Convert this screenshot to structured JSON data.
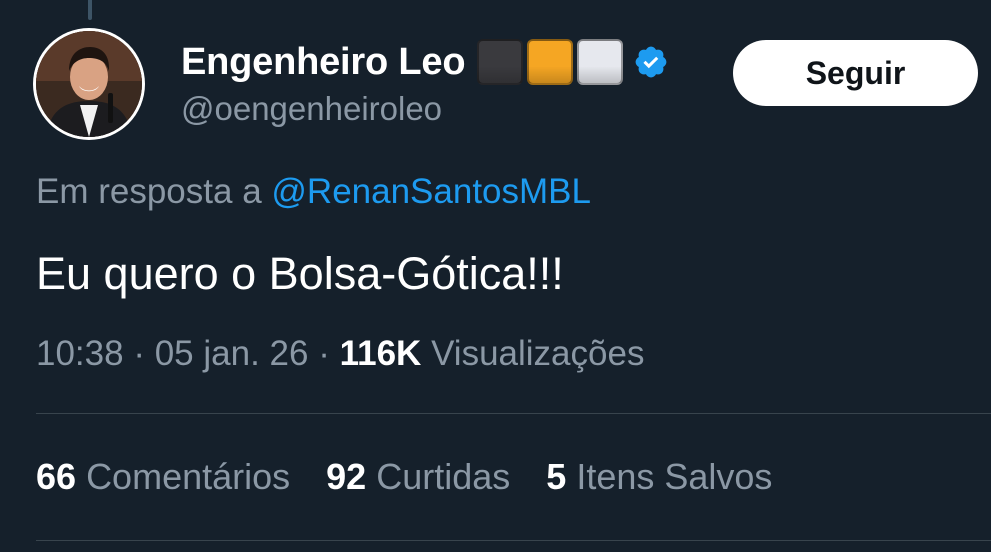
{
  "author": {
    "display_name": "Engenheiro Leo",
    "handle": "@oengenheiroleo",
    "verified_icon": "verified-badge-icon",
    "flag_colors": [
      "#3a3a3e",
      "#f5a623",
      "#e6e8ee"
    ]
  },
  "follow_label": "Seguir",
  "reply": {
    "prefix": "Em resposta a",
    "mention": "@RenanSantosMBL"
  },
  "tweet_text": "Eu quero o Bolsa-Gótica!!!",
  "meta": {
    "time": "10:38",
    "separator": "·",
    "date": "05 jan. 26",
    "views_count": "116K",
    "views_label": "Visualizações"
  },
  "stats": {
    "comments_count": "66",
    "comments_label": "Comentários",
    "likes_count": "92",
    "likes_label": "Curtidas",
    "saves_count": "5",
    "saves_label": "Itens Salvos"
  },
  "colors": {
    "background": "#15202b",
    "accent_link": "#1d9bf0",
    "muted_text": "#8b98a5"
  }
}
